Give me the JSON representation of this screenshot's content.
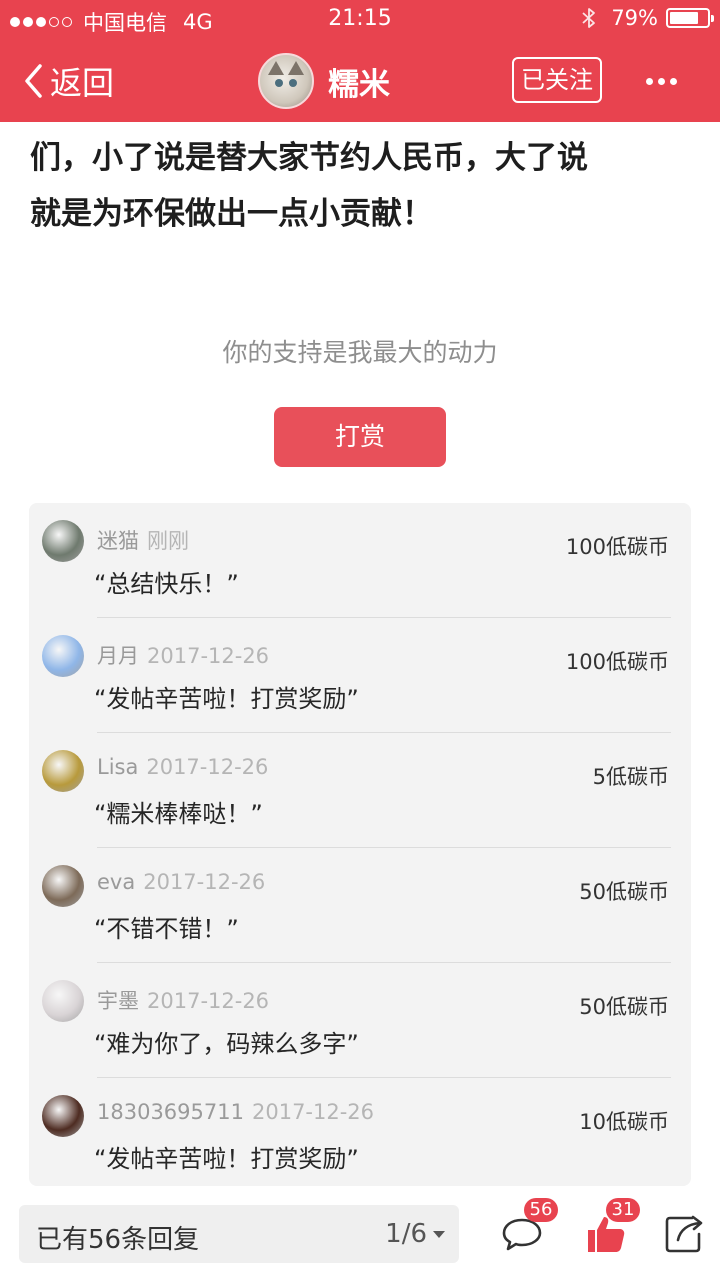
{
  "status_bar": {
    "carrier": "中国电信",
    "network": "4G",
    "time": "21:15",
    "battery": "79%",
    "battery_level": 0.79,
    "signal_bars": 3,
    "signal_total": 5
  },
  "nav": {
    "back_label": "返回",
    "username": "糯米",
    "follow_label": "已关注"
  },
  "post": {
    "line1": "们，小了说是替大家节约人民币，大了说",
    "line2": "就是为环保做出一点小贡献！"
  },
  "support": {
    "text": "你的支持是我最大的动力",
    "reward_button": "打赏"
  },
  "rewards": [
    {
      "name": "迷猫",
      "date": "刚刚",
      "message": "“总结快乐！”",
      "amount": "100低碳币",
      "avatar_color": "#6f7a6e"
    },
    {
      "name": "月月",
      "date": "2017-12-26",
      "message": "“发帖辛苦啦！打赏奖励”",
      "amount": "100低碳币",
      "avatar_color": "#8fb6e8"
    },
    {
      "name": "Lisa",
      "date": "2017-12-26",
      "message": "“糯米棒棒哒！”",
      "amount": "5低碳币",
      "avatar_color": "#b89a3c"
    },
    {
      "name": "eva",
      "date": "2017-12-26",
      "message": "“不错不错！”",
      "amount": "50低碳币",
      "avatar_color": "#7d6a58"
    },
    {
      "name": "宇墨",
      "date": "2017-12-26",
      "message": "“难为你了，码辣么多字”",
      "amount": "50低碳币",
      "avatar_color": "#d9d4d6"
    },
    {
      "name": "18303695711",
      "date": "2017-12-26",
      "message": "“发帖辛苦啦！打赏奖励”",
      "amount": "10低碳币",
      "avatar_color": "#4e2c22"
    }
  ],
  "bottom": {
    "reply_count": "已有56条回复",
    "page": "1/6",
    "comment_badge": "56",
    "like_badge": "31",
    "accent": "#e8434f"
  }
}
